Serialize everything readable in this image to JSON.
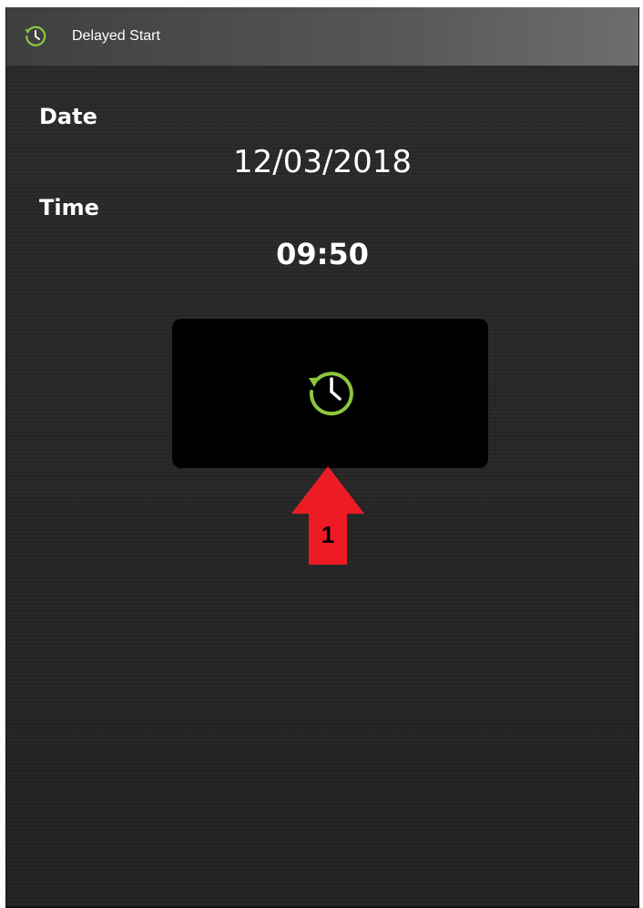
{
  "app": {
    "title": "Delayed Start",
    "title_icon": "clock-restart-icon"
  },
  "form": {
    "date_label": "Date",
    "date_value": "12/03/2018",
    "time_label": "Time",
    "time_value": "09:50"
  },
  "start_button": {
    "icon": "delayed-start-clock-icon",
    "icon_color": "#8dc63f"
  },
  "annotation": {
    "number": "1",
    "color": "#ed1c24",
    "icon": "arrow-up-icon"
  },
  "colors": {
    "accent": "#8dc63f",
    "background": "#262626",
    "titlebar": "#555657",
    "button": "#000000"
  }
}
